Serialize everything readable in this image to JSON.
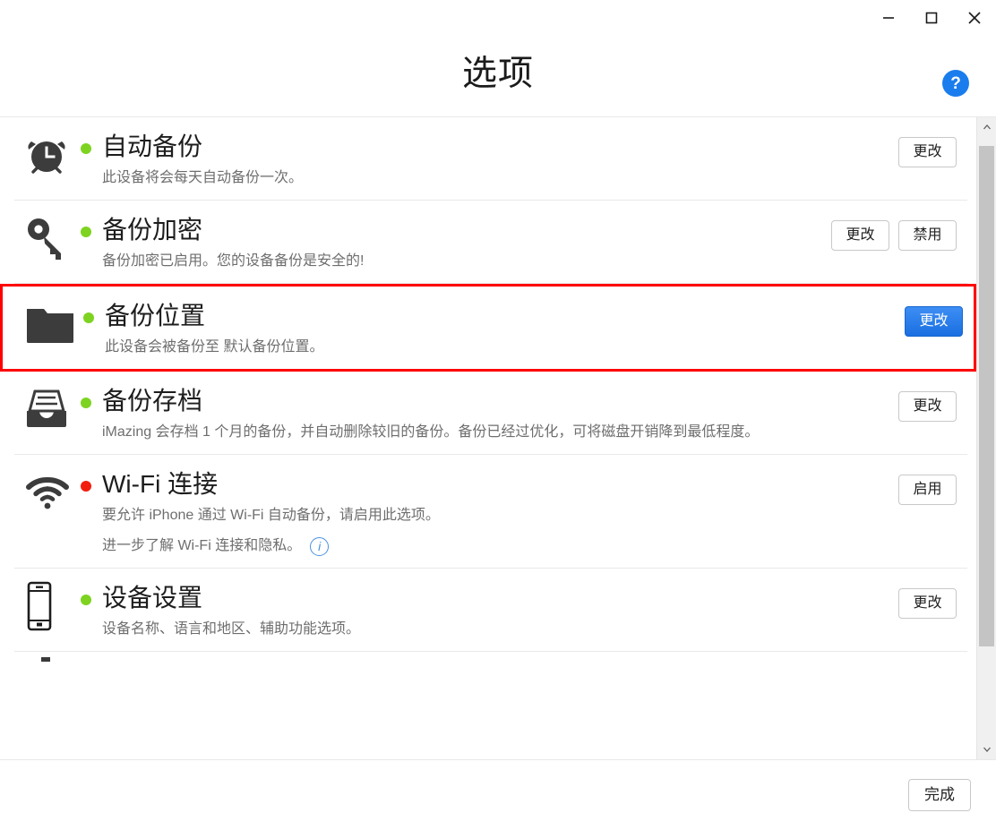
{
  "window": {
    "title": "选项",
    "controls": {
      "minimize": "minimize-icon",
      "maximize": "maximize-icon",
      "close": "close-icon"
    },
    "help_label": "?"
  },
  "options": [
    {
      "icon": "alarm-clock-icon",
      "status": "green",
      "title": "自动备份",
      "desc": "此设备将会每天自动备份一次。",
      "desc2": null,
      "info_icon": false,
      "highlighted": false,
      "buttons": [
        {
          "label": "更改",
          "primary": false
        }
      ]
    },
    {
      "icon": "key-icon",
      "status": "green",
      "title": "备份加密",
      "desc": "备份加密已启用。您的设备备份是安全的!",
      "desc2": null,
      "info_icon": false,
      "highlighted": false,
      "buttons": [
        {
          "label": "更改",
          "primary": false
        },
        {
          "label": "禁用",
          "primary": false
        }
      ]
    },
    {
      "icon": "folder-icon",
      "status": "green",
      "title": "备份位置",
      "desc": "此设备会被备份至 默认备份位置。",
      "desc2": null,
      "info_icon": false,
      "highlighted": true,
      "buttons": [
        {
          "label": "更改",
          "primary": true
        }
      ]
    },
    {
      "icon": "archive-tray-icon",
      "status": "green",
      "title": "备份存档",
      "desc": "iMazing 会存档 1 个月的备份，并自动删除较旧的备份。备份已经过优化，可将磁盘开销降到最低程度。",
      "desc2": null,
      "info_icon": false,
      "highlighted": false,
      "buttons": [
        {
          "label": "更改",
          "primary": false
        }
      ]
    },
    {
      "icon": "wifi-icon",
      "status": "red",
      "title": "Wi-Fi 连接",
      "desc": "要允许 iPhone 通过 Wi-Fi 自动备份，请启用此选项。",
      "desc2": "进一步了解 Wi-Fi 连接和隐私。",
      "info_icon": true,
      "highlighted": false,
      "buttons": [
        {
          "label": "启用",
          "primary": false
        }
      ]
    },
    {
      "icon": "phone-icon",
      "status": "green",
      "title": "设备设置",
      "desc": "设备名称、语言和地区、辅助功能选项。",
      "desc2": null,
      "info_icon": false,
      "highlighted": false,
      "buttons": [
        {
          "label": "更改",
          "primary": false
        }
      ]
    }
  ],
  "scrollbar": {
    "up_icon": "chevron-up-icon",
    "down_icon": "chevron-down-icon"
  },
  "footer": {
    "done_label": "完成"
  },
  "colors": {
    "accent_blue": "#1a7ded",
    "primary_button": "#2479ea",
    "status_green": "#7ed321",
    "status_red": "#f21d0d",
    "highlight_red": "#ff0000",
    "info_blue": "#4a90e2"
  }
}
